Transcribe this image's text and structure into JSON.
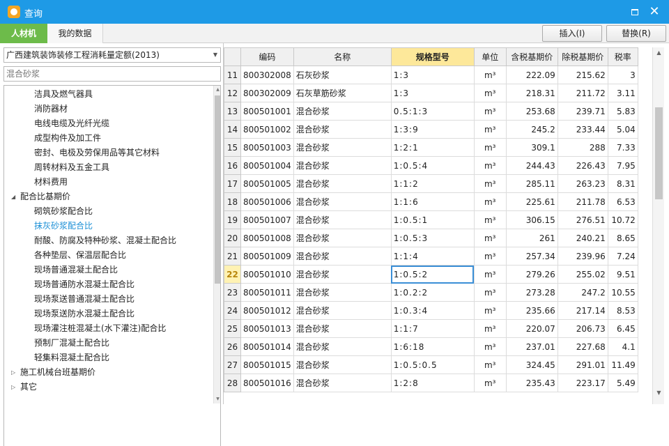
{
  "window": {
    "title": "查询",
    "max_icon": "maximize-icon",
    "close_icon": "close-icon"
  },
  "tabs": [
    {
      "label": "人材机"
    },
    {
      "label": "我的数据"
    }
  ],
  "toolbar": {
    "insert_label": "插入(I)",
    "replace_label": "替换(R)"
  },
  "left": {
    "quota_select": "广西建筑装饰装修工程消耗量定额(2013)",
    "search_placeholder": "混合砂浆",
    "tree": [
      {
        "label": "洁具及燃气器具",
        "level": 2
      },
      {
        "label": "消防器材",
        "level": 2
      },
      {
        "label": "电线电缆及光纤光缆",
        "level": 2
      },
      {
        "label": "成型构件及加工件",
        "level": 2
      },
      {
        "label": "密封、电极及劳保用品等其它材料",
        "level": 2
      },
      {
        "label": "周转材料及五金工具",
        "level": 2
      },
      {
        "label": "材料费用",
        "level": 2
      },
      {
        "label": "配合比基期价",
        "level": 1,
        "expanded": true
      },
      {
        "label": "砌筑砂浆配合比",
        "level": 2
      },
      {
        "label": "抹灰砂浆配合比",
        "level": 2,
        "selected": true
      },
      {
        "label": "耐酸、防腐及特种砂浆、混凝土配合比",
        "level": 2
      },
      {
        "label": "各种垫层、保温层配合比",
        "level": 2
      },
      {
        "label": "现场普通混凝土配合比",
        "level": 2
      },
      {
        "label": "现场普通防水混凝土配合比",
        "level": 2
      },
      {
        "label": "现场泵送普通混凝土配合比",
        "level": 2
      },
      {
        "label": "现场泵送防水混凝土配合比",
        "level": 2
      },
      {
        "label": "现场灌注桩混凝土(水下灌注)配合比",
        "level": 2
      },
      {
        "label": "预制厂混凝土配合比",
        "level": 2
      },
      {
        "label": "轻集料混凝土配合比",
        "level": 2
      },
      {
        "label": "施工机械台班基期价",
        "level": 1,
        "expanded": false
      },
      {
        "label": "其它",
        "level": 1,
        "expanded": false
      }
    ]
  },
  "table": {
    "headers": [
      "编码",
      "名称",
      "规格型号",
      "单位",
      "含税基期价",
      "除税基期价",
      "税率"
    ],
    "current_row": 22,
    "rows": [
      {
        "n": "11",
        "code": "800302008",
        "name": "石灰砂浆",
        "spec": "1:3",
        "unit": "m³",
        "price_tax": "222.09",
        "price_notax": "215.62",
        "rate": "3"
      },
      {
        "n": "12",
        "code": "800302009",
        "name": "石灰草筋砂浆",
        "spec": "1:3",
        "unit": "m³",
        "price_tax": "218.31",
        "price_notax": "211.72",
        "rate": "3.11"
      },
      {
        "n": "13",
        "code": "800501001",
        "name": "混合砂浆",
        "spec": "0.5:1:3",
        "unit": "m³",
        "price_tax": "253.68",
        "price_notax": "239.71",
        "rate": "5.83"
      },
      {
        "n": "14",
        "code": "800501002",
        "name": "混合砂浆",
        "spec": "1:3:9",
        "unit": "m³",
        "price_tax": "245.2",
        "price_notax": "233.44",
        "rate": "5.04"
      },
      {
        "n": "15",
        "code": "800501003",
        "name": "混合砂浆",
        "spec": "1:2:1",
        "unit": "m³",
        "price_tax": "309.1",
        "price_notax": "288",
        "rate": "7.33"
      },
      {
        "n": "16",
        "code": "800501004",
        "name": "混合砂浆",
        "spec": "1:0.5:4",
        "unit": "m³",
        "price_tax": "244.43",
        "price_notax": "226.43",
        "rate": "7.95"
      },
      {
        "n": "17",
        "code": "800501005",
        "name": "混合砂浆",
        "spec": "1:1:2",
        "unit": "m³",
        "price_tax": "285.11",
        "price_notax": "263.23",
        "rate": "8.31"
      },
      {
        "n": "18",
        "code": "800501006",
        "name": "混合砂浆",
        "spec": "1:1:6",
        "unit": "m³",
        "price_tax": "225.61",
        "price_notax": "211.78",
        "rate": "6.53"
      },
      {
        "n": "19",
        "code": "800501007",
        "name": "混合砂浆",
        "spec": "1:0.5:1",
        "unit": "m³",
        "price_tax": "306.15",
        "price_notax": "276.51",
        "rate": "10.72"
      },
      {
        "n": "20",
        "code": "800501008",
        "name": "混合砂浆",
        "spec": "1:0.5:3",
        "unit": "m³",
        "price_tax": "261",
        "price_notax": "240.21",
        "rate": "8.65"
      },
      {
        "n": "21",
        "code": "800501009",
        "name": "混合砂浆",
        "spec": "1:1:4",
        "unit": "m³",
        "price_tax": "257.34",
        "price_notax": "239.96",
        "rate": "7.24"
      },
      {
        "n": "22",
        "code": "800501010",
        "name": "混合砂浆",
        "spec": "1:0.5:2",
        "unit": "m³",
        "price_tax": "279.26",
        "price_notax": "255.02",
        "rate": "9.51"
      },
      {
        "n": "23",
        "code": "800501011",
        "name": "混合砂浆",
        "spec": "1:0.2:2",
        "unit": "m³",
        "price_tax": "273.28",
        "price_notax": "247.2",
        "rate": "10.55"
      },
      {
        "n": "24",
        "code": "800501012",
        "name": "混合砂浆",
        "spec": "1:0.3:4",
        "unit": "m³",
        "price_tax": "235.66",
        "price_notax": "217.14",
        "rate": "8.53"
      },
      {
        "n": "25",
        "code": "800501013",
        "name": "混合砂浆",
        "spec": "1:1:7",
        "unit": "m³",
        "price_tax": "220.07",
        "price_notax": "206.73",
        "rate": "6.45"
      },
      {
        "n": "26",
        "code": "800501014",
        "name": "混合砂浆",
        "spec": "1:6:18",
        "unit": "m³",
        "price_tax": "237.01",
        "price_notax": "227.68",
        "rate": "4.1"
      },
      {
        "n": "27",
        "code": "800501015",
        "name": "混合砂浆",
        "spec": "1:0.5:0.5",
        "unit": "m³",
        "price_tax": "324.45",
        "price_notax": "291.01",
        "rate": "11.49"
      },
      {
        "n": "28",
        "code": "800501016",
        "name": "混合砂浆",
        "spec": "1:2:8",
        "unit": "m³",
        "price_tax": "235.43",
        "price_notax": "223.17",
        "rate": "5.49"
      }
    ]
  }
}
